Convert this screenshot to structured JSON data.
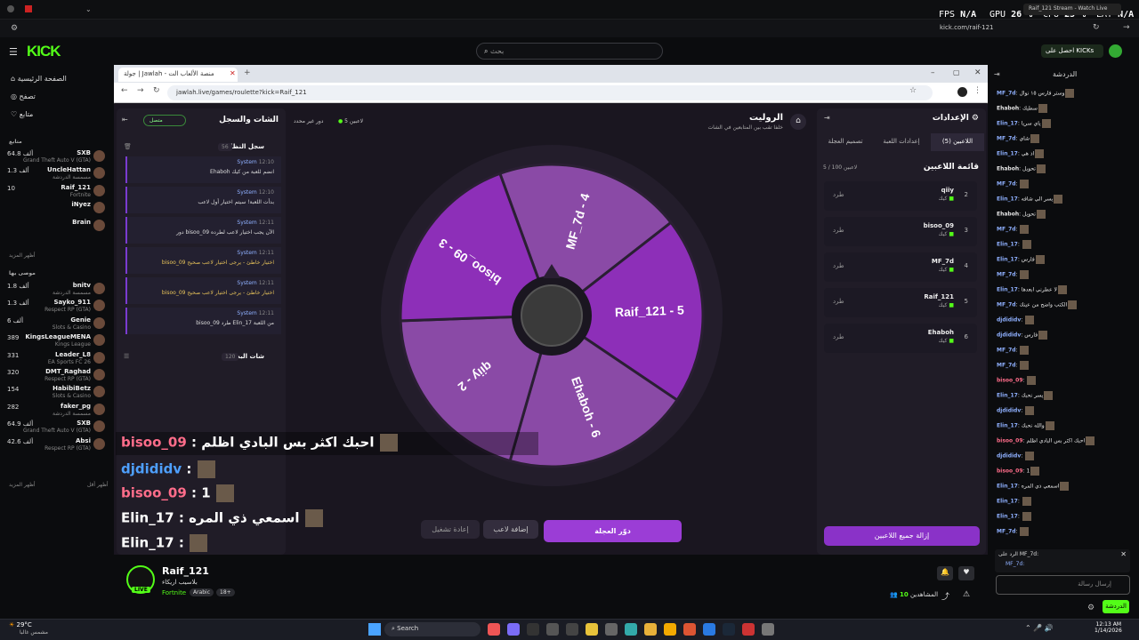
{
  "os": {
    "fps_label": "FPS",
    "fps_value": "N/A",
    "gpu_label": "GPU",
    "gpu_value": "26 %",
    "cpu_label": "CPU",
    "cpu_value": "25 %",
    "lat_label": "LAT",
    "lat_value": "N/A",
    "tab_title": "Raif_121 Stream - Watch Live",
    "url": "kick.com/raif-121"
  },
  "kick": {
    "logo": "KICK",
    "search_placeholder": "بحث",
    "get_kicks": "احصل على KICKs",
    "chat_header": "الدردشة"
  },
  "sidebar": {
    "nav": [
      "الصفحة الرئيسية",
      "تصفح",
      "متابع"
    ],
    "following_header": "متابع",
    "recommended_header": "موصى بها",
    "show_more": "أظهر المزيد",
    "channels_followed": [
      {
        "name": "SXB",
        "game": "Grand Theft Auto V (GTA)",
        "viewers": "64.8 ألف"
      },
      {
        "name": "UncleHattan",
        "game": "مسمسة الدردشة",
        "viewers": "1.3 ألف"
      },
      {
        "name": "Raif_121",
        "game": "Fortnite",
        "viewers": "10"
      },
      {
        "name": "iNyez",
        "game": "",
        "viewers": ""
      },
      {
        "name": "Brain",
        "game": "",
        "viewers": ""
      }
    ],
    "channels_recommended": [
      {
        "name": "bnitv",
        "game": "مسمسة الدردشة",
        "viewers": "1.8 ألف"
      },
      {
        "name": "Sayko_911",
        "game": "Respect RP (GTA)",
        "viewers": "1.3 ألف"
      },
      {
        "name": "Genie",
        "game": "Slots & Casino",
        "viewers": "6 ألف"
      },
      {
        "name": "KingsLeagueMENA",
        "game": "Kings League",
        "viewers": "389"
      },
      {
        "name": "Leader_L8",
        "game": "EA Sports FC 26",
        "viewers": "331"
      },
      {
        "name": "DMT_Raghad",
        "game": "Respect RP (GTA)",
        "viewers": "320"
      },
      {
        "name": "HabibiBetz",
        "game": "Slots & Casino",
        "viewers": "154"
      },
      {
        "name": "faker_pg",
        "game": "مسمسة الدردشة",
        "viewers": "282"
      },
      {
        "name": "SXB",
        "game": "Grand Theft Auto V (GTA)",
        "viewers": "64.9 ألف"
      },
      {
        "name": "Absi",
        "game": "Respect RP (GTA)",
        "viewers": "42.6 ألف"
      }
    ],
    "show_more_2": "أظهر المزيد",
    "show_less": "أظهر أقل"
  },
  "browser": {
    "tab_title": "جولة | Jawlah - منصة الألعاب الت",
    "url": "jawlah.live/games/roulette?kick=Raif_121"
  },
  "game": {
    "title": "الروليت",
    "subtitle": "خلفا تقب بين المتابعين في الشات",
    "players_count": "5 لاعبين",
    "turn_label": "دور غير محدد",
    "chat_log_title": "الشات والسجل",
    "online": "متصل",
    "system_log_title": "سجل النظام",
    "system_log_count": "56",
    "system_messages": [
      {
        "time": "12:10",
        "tag": "System",
        "msg": "Ehaboh انضم للعبة من كيك",
        "warn": false
      },
      {
        "time": "12:10",
        "tag": "System",
        "msg": "بدأت اللعبة! سيتم اختيار أول لاعب",
        "warn": false
      },
      {
        "time": "12:11",
        "tag": "System",
        "msg": "دور bisoo_09 الآن يجب اختيار لاعب لطرده",
        "warn": false
      },
      {
        "time": "12:11",
        "tag": "System",
        "msg": "bisoo_09 اختيار خاطئ - يرجى اختيار لاعب صحيح",
        "warn": true
      },
      {
        "time": "12:11",
        "tag": "System",
        "msg": "bisoo_09 اختيار خاطئ - يرجى اختيار لاعب صحيح",
        "warn": true
      },
      {
        "time": "12:11",
        "tag": "System",
        "msg": "bisoo_09 طرد Elin_17 من اللعبة",
        "warn": false
      }
    ],
    "live_chat_title": "شات البث",
    "live_chat_count": "120",
    "settings_title": "الإعدادات",
    "settings_tabs": [
      "اللاعبين (5)",
      "إعدادات اللعبة",
      "تصميم العجلة"
    ],
    "player_list_title": "قائمة اللاعبين",
    "player_list_count": "5 / 100 لاعبين",
    "kick_label": "طرد",
    "platform_label": "كيك",
    "players": [
      {
        "name": "qiiy",
        "num": "2"
      },
      {
        "name": "bisoo_09",
        "num": "3"
      },
      {
        "name": "MF_7d",
        "num": "4"
      },
      {
        "name": "Raif_121",
        "num": "5"
      },
      {
        "name": "Ehaboh",
        "num": "6"
      }
    ],
    "remove_all": "إزالة جميع اللاعبين",
    "spin_button": "دوّر العجلة",
    "add_player": "إضافة لاعب",
    "restart": "إعادة تشغيل",
    "wheel_labels": [
      "MF_7d - 4",
      "Raif_121 - 5",
      "Ehaboh - 6",
      "qiiy - 2",
      "bisoo_09 - 3"
    ]
  },
  "overlay_chat": [
    {
      "user": "bisoo_09",
      "msg": "احبك اكثر بس البادي اظلم",
      "color": "#ff6d8a"
    },
    {
      "user": "djdididv",
      "msg": "",
      "color": "#4ea0ff"
    },
    {
      "user": "bisoo_09",
      "msg": "1",
      "color": "#ff6d8a"
    },
    {
      "user": "Elin_17",
      "msg": "اسمعي ذي المره",
      "color": "#ffffff"
    },
    {
      "user": "Elin_17",
      "msg": "",
      "color": "#ffffff"
    }
  ],
  "stream": {
    "channel": "Raif_121",
    "title": "بلاسيب اريكاء",
    "category": "Fortnite",
    "tags": [
      "Arabic",
      "18+"
    ],
    "live": "LIVE",
    "viewers_label": "المشاهدين",
    "viewers": "10"
  },
  "right_chat": {
    "lines": [
      {
        "user": "MF_7d",
        "text": "وستر فارس ١٥ نوال",
        "cls": "u-b"
      },
      {
        "user": "Ehaboh",
        "text": "سطيك",
        "cls": "u-w"
      },
      {
        "user": "Elin_17",
        "text": "ياي سريا",
        "cls": "u-b"
      },
      {
        "user": "MF_7d",
        "text": "شاي",
        "cls": "u-b"
      },
      {
        "user": "Elin_17",
        "text": "اذ هي",
        "cls": "u-b"
      },
      {
        "user": "Ehaboh",
        "text": "تحويل",
        "cls": "u-w"
      },
      {
        "user": "MF_7d",
        "text": "",
        "cls": "u-b"
      },
      {
        "user": "Elin_17",
        "text": "يسر الي شافه",
        "cls": "u-b"
      },
      {
        "user": "Ehaboh",
        "text": "تحويل",
        "cls": "u-w"
      },
      {
        "user": "MF_7d",
        "text": "",
        "cls": "u-b"
      },
      {
        "user": "Elin_17",
        "text": "",
        "cls": "u-b"
      },
      {
        "user": "Elin_17",
        "text": "فارس",
        "cls": "u-b"
      },
      {
        "user": "MF_7d",
        "text": "",
        "cls": "u-b"
      },
      {
        "user": "Elin_17",
        "text": "لا عطرني ابعدها",
        "cls": "u-b"
      },
      {
        "user": "MF_7d",
        "text": "الكتب واضح من عينك",
        "cls": "u-b"
      },
      {
        "user": "djdididv",
        "text": "",
        "cls": "u-b"
      },
      {
        "user": "djdididv",
        "text": "فارس",
        "cls": "u-b"
      },
      {
        "user": "MF_7d",
        "text": "",
        "cls": "u-b"
      },
      {
        "user": "MF_7d",
        "text": "",
        "cls": "u-b"
      },
      {
        "user": "bisoo_09",
        "text": "",
        "cls": "u-r"
      },
      {
        "user": "Elin_17",
        "text": "يسر نحبك",
        "cls": "u-b"
      },
      {
        "user": "djdididv",
        "text": "",
        "cls": "u-b"
      },
      {
        "user": "Elin_17",
        "text": "والله نحبك",
        "cls": "u-b"
      },
      {
        "user": "bisoo_09",
        "text": "احبك اكثر بس البادي اظلم",
        "cls": "u-r"
      },
      {
        "user": "djdididv",
        "text": "",
        "cls": "u-b"
      },
      {
        "user": "bisoo_09",
        "text": "1",
        "cls": "u-r"
      },
      {
        "user": "Elin_17",
        "text": "اسمعي ذي المره",
        "cls": "u-b"
      },
      {
        "user": "Elin_17",
        "text": "",
        "cls": "u-b"
      },
      {
        "user": "Elin_17",
        "text": "",
        "cls": "u-b"
      },
      {
        "user": "MF_7d",
        "text": "",
        "cls": "u-b"
      }
    ],
    "reply_label": "الرد على MF_7d:",
    "reply_user": "MF_7d:",
    "input_placeholder": "إرسال رسالة",
    "chat_button": "الدردشة"
  },
  "taskbar": {
    "weather_temp": "29°C",
    "weather_desc": "مشمس غالبا",
    "search": "Search",
    "time": "12:13 AM",
    "date": "1/14/2026"
  }
}
